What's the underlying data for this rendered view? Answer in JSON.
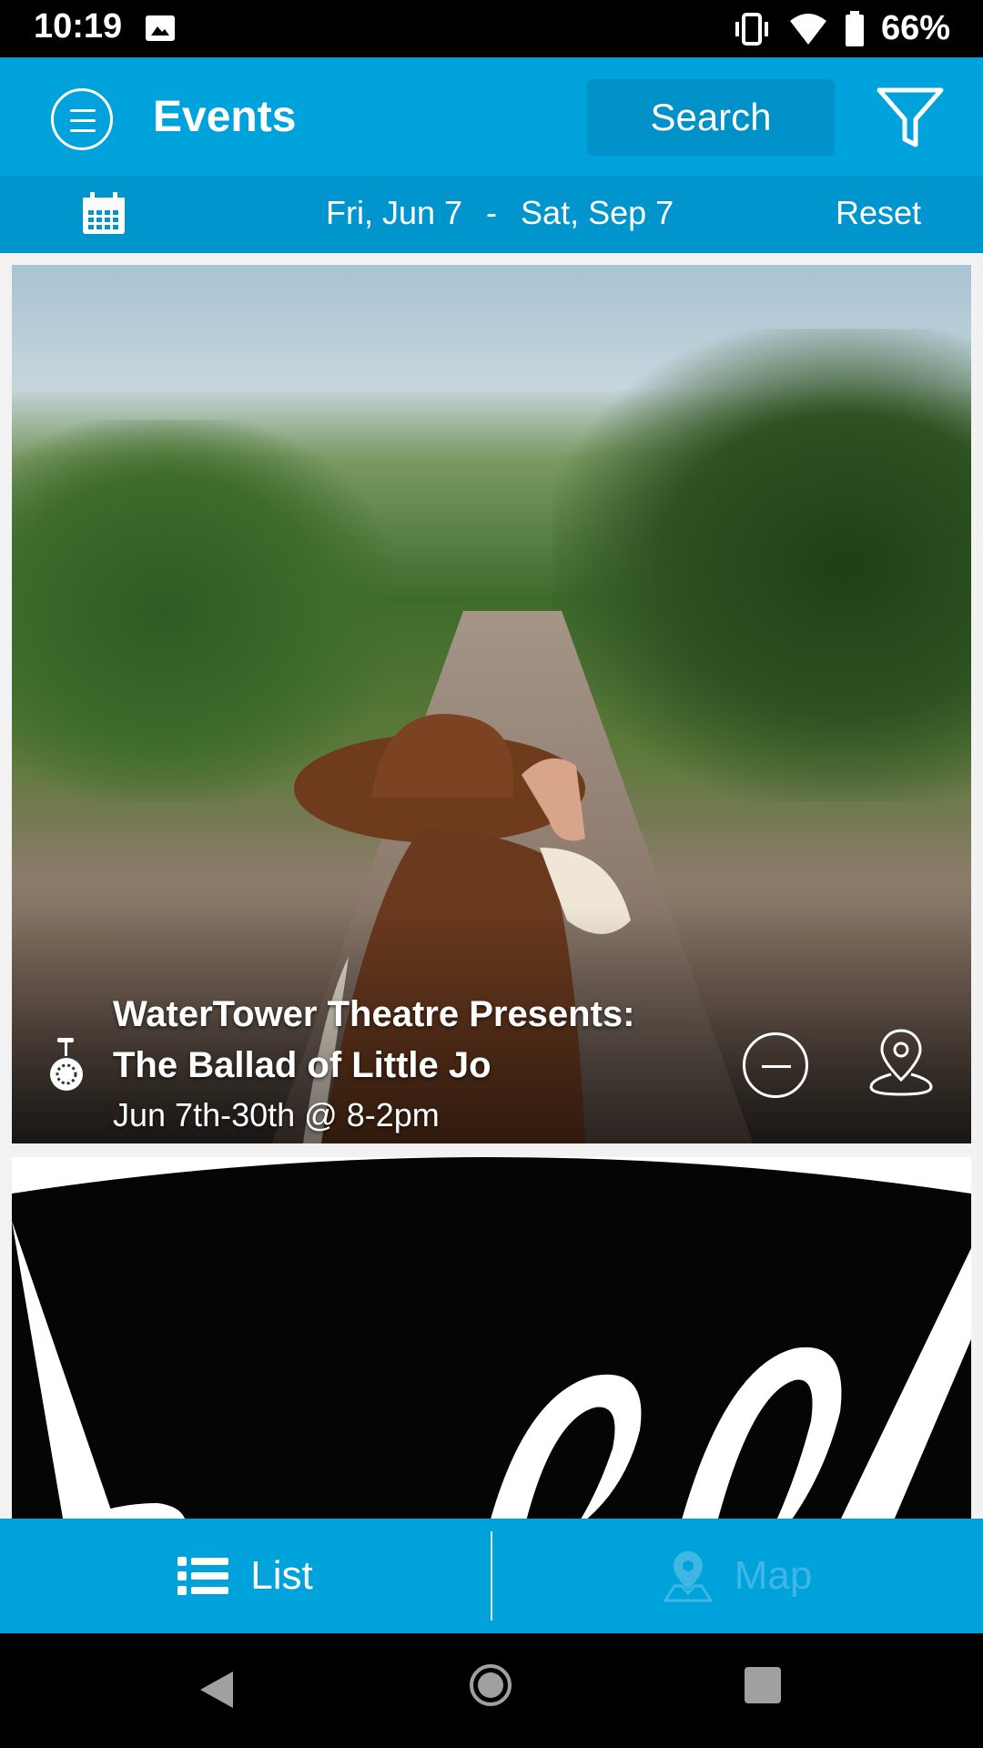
{
  "status_bar": {
    "time": "10:19",
    "battery": "66%"
  },
  "app_bar": {
    "title": "Events",
    "search_label": "Search"
  },
  "date_bar": {
    "start": "Fri, Jun 7",
    "separator": "-",
    "end": "Sat, Sep 7",
    "reset_label": "Reset"
  },
  "events": [
    {
      "title": "WaterTower Theatre Presents: The Ballad of Little Jo",
      "date": "Jun 7th-30th @ 8-2pm",
      "category_icon": "unicycle-icon"
    }
  ],
  "tabs": [
    {
      "label": "List",
      "active": true
    },
    {
      "label": "Map",
      "active": false
    }
  ],
  "colors": {
    "primary": "#00a2dc",
    "date_bar": "#0096cd",
    "inactive_tab": "#3fb6e3"
  }
}
